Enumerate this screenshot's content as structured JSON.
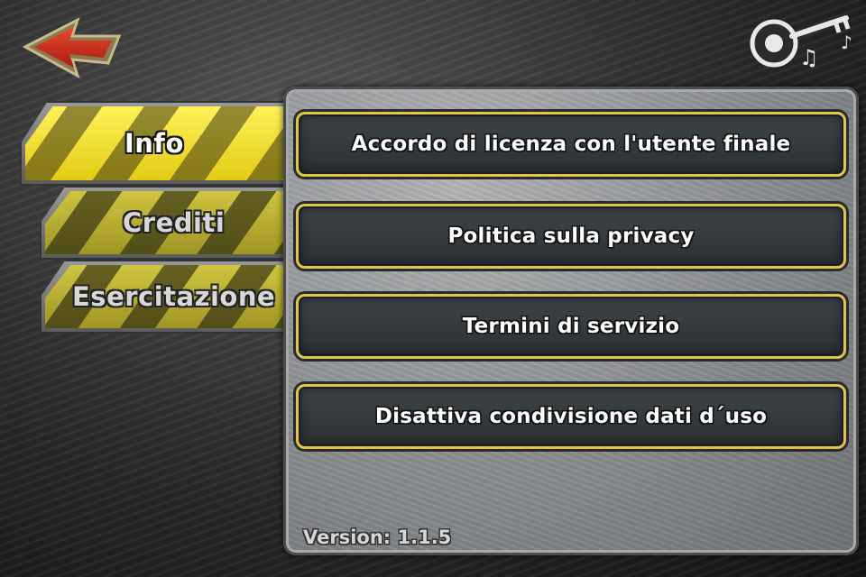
{
  "header": {
    "back_icon": "back-arrow-icon",
    "audio_icon": "audio-key-icon",
    "accent_color": "#c8281c"
  },
  "tabs": [
    {
      "label": "Info",
      "active": true
    },
    {
      "label": "Crediti",
      "active": false
    },
    {
      "label": "Esercitazione",
      "active": false
    }
  ],
  "menu": {
    "items": [
      {
        "label": "Accordo di licenza con l'utente finale"
      },
      {
        "label": "Politica sulla privacy"
      },
      {
        "label": "Termini di servizio"
      },
      {
        "label": "Disattiva condivisione dati d´uso"
      }
    ],
    "button_border_color": "#e2c548"
  },
  "version_text": "Version: 1.1.5"
}
